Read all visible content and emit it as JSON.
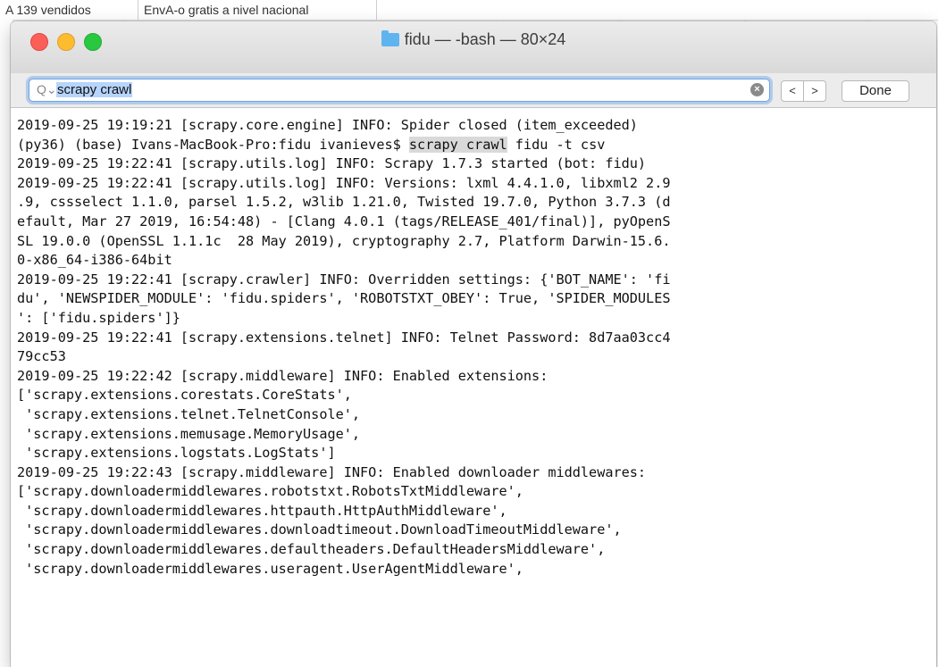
{
  "background": {
    "cells": [
      "A 139 vendidos",
      "EnvA-o gratis a nivel nacional"
    ]
  },
  "window": {
    "title": "fidu — -bash — 80×24",
    "folder_icon": "folder-icon"
  },
  "find_bar": {
    "search_value": "scrapy crawl",
    "prev_label": "<",
    "next_label": ">",
    "done_label": "Done"
  },
  "terminal": {
    "lines": [
      "2019-09-25 19:19:21 [scrapy.core.engine] INFO: Spider closed (item_exceeded)",
      "(py36) (base) Ivans-MacBook-Pro:fidu ivanieves$ ",
      "2019-09-25 19:22:41 [scrapy.utils.log] INFO: Scrapy 1.7.3 started (bot: fidu)",
      "2019-09-25 19:22:41 [scrapy.utils.log] INFO: Versions: lxml 4.4.1.0, libxml2 2.9",
      ".9, cssselect 1.1.0, parsel 1.5.2, w3lib 1.21.0, Twisted 19.7.0, Python 3.7.3 (d",
      "efault, Mar 27 2019, 16:54:48) - [Clang 4.0.1 (tags/RELEASE_401/final)], pyOpenS",
      "SL 19.0.0 (OpenSSL 1.1.1c  28 May 2019), cryptography 2.7, Platform Darwin-15.6.",
      "0-x86_64-i386-64bit",
      "2019-09-25 19:22:41 [scrapy.crawler] INFO: Overridden settings: {'BOT_NAME': 'fi",
      "du', 'NEWSPIDER_MODULE': 'fidu.spiders', 'ROBOTSTXT_OBEY': True, 'SPIDER_MODULES",
      "': ['fidu.spiders']}",
      "2019-09-25 19:22:41 [scrapy.extensions.telnet] INFO: Telnet Password: 8d7aa03cc4",
      "79cc53",
      "2019-09-25 19:22:42 [scrapy.middleware] INFO: Enabled extensions:",
      "['scrapy.extensions.corestats.CoreStats',",
      " 'scrapy.extensions.telnet.TelnetConsole',",
      " 'scrapy.extensions.memusage.MemoryUsage',",
      " 'scrapy.extensions.logstats.LogStats']",
      "2019-09-25 19:22:43 [scrapy.middleware] INFO: Enabled downloader middlewares:",
      "['scrapy.downloadermiddlewares.robotstxt.RobotsTxtMiddleware',",
      " 'scrapy.downloadermiddlewares.httpauth.HttpAuthMiddleware',",
      " 'scrapy.downloadermiddlewares.downloadtimeout.DownloadTimeoutMiddleware',",
      " 'scrapy.downloadermiddlewares.defaultheaders.DefaultHeadersMiddleware',",
      " 'scrapy.downloadermiddlewares.useragent.UserAgentMiddleware',"
    ],
    "prompt_match": "scrapy crawl",
    "prompt_rest": " fidu -t csv"
  }
}
